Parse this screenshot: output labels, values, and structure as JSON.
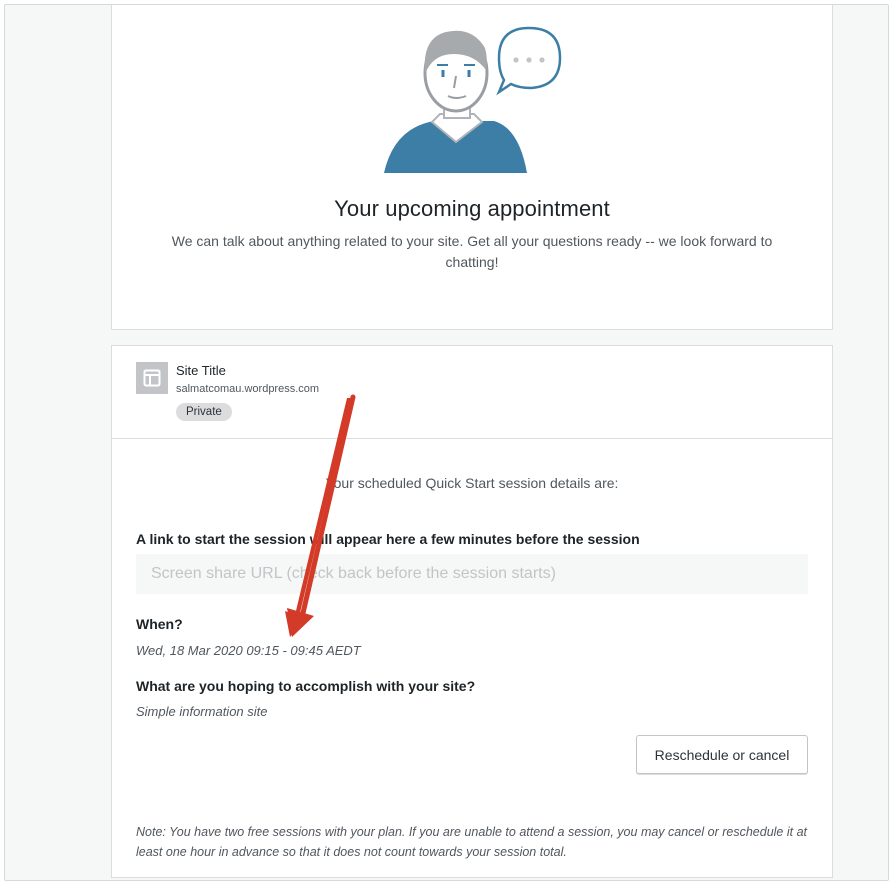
{
  "intro_card": {
    "title": "Your upcoming appointment",
    "subtitle": "We can talk about anything related to your site. Get all your questions ready -- we look forward to chatting!",
    "illustration": "support-person-chat-illustration",
    "speech_bubble_text": "• • •"
  },
  "site": {
    "icon": "site-layout-icon",
    "title": "Site Title",
    "url": "salmatcomau.wordpress.com",
    "badge": "Private"
  },
  "session": {
    "intro": "Your scheduled Quick Start session details are:",
    "link_label": "A link to start the session will appear here a few minutes before the session",
    "url_placeholder": "Screen share URL (check back before the session starts)",
    "when_label": "When?",
    "when_value": "Wed, 18 Mar 2020 09:15 - 09:45 AEDT",
    "goal_label": "What are you hoping to accomplish with your site?",
    "goal_value": "Simple information site",
    "reschedule_button": "Reschedule or cancel",
    "note": "Note: You have two free sessions with your plan. If you are unable to attend a session, you may cancel or reschedule it at least one hour in advance so that it does not count towards your session total."
  },
  "colors": {
    "accent_blue": "#3d7ea6",
    "annotation_arrow": "#d33a28",
    "page_background": "#f6f7f7"
  }
}
